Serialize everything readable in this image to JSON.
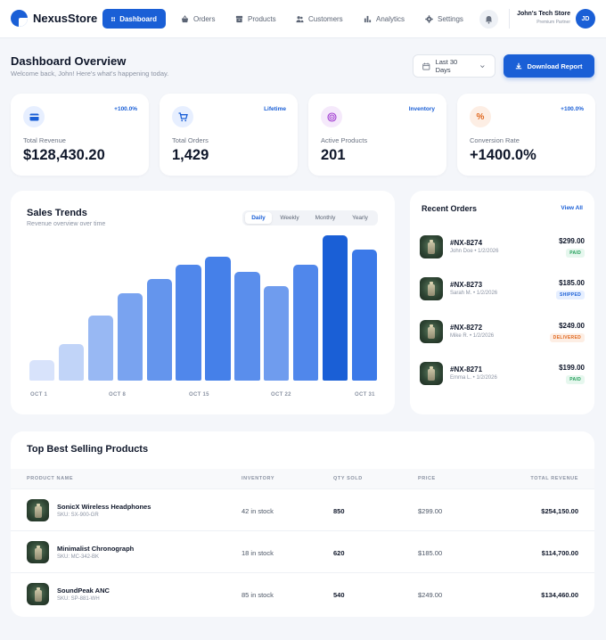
{
  "brand": {
    "name": "NexusStore",
    "color": "#1a5fd6"
  },
  "nav": {
    "tabs": [
      {
        "label": "Dashboard",
        "icon": "grid-icon",
        "active": true
      },
      {
        "label": "Orders",
        "icon": "basket-icon"
      },
      {
        "label": "Products",
        "icon": "box-icon"
      },
      {
        "label": "Customers",
        "icon": "users-icon"
      },
      {
        "label": "Analytics",
        "icon": "bar-chart-icon"
      },
      {
        "label": "Settings",
        "icon": "gear-icon"
      }
    ],
    "store_name": "John's Tech Store",
    "store_tier": "Premium Partner",
    "avatar_initials": "JD"
  },
  "header": {
    "title": "Dashboard Overview",
    "subtitle": "Welcome back, John! Here's what's happening today.",
    "date_range": "Last 30 Days",
    "download_label": "Download Report"
  },
  "kpis": [
    {
      "label": "Total Revenue",
      "value": "$128,430.20",
      "badge": "+100.0%",
      "icon": "card-icon",
      "icon_bg": "#e7efff",
      "icon_color": "#1a5fd6"
    },
    {
      "label": "Total Orders",
      "value": "1,429",
      "badge": "Lifetime",
      "icon": "cart-icon",
      "icon_bg": "#e7efff",
      "icon_color": "#1a5fd6"
    },
    {
      "label": "Active Products",
      "value": "201",
      "badge": "Inventory",
      "icon": "target-icon",
      "icon_bg": "#f5e9fb",
      "icon_color": "#a23fd1"
    },
    {
      "label": "Conversion Rate",
      "value": "+1400.0%",
      "badge": "+100.0%",
      "icon": "percent-icon",
      "icon_bg": "#fdeee4",
      "icon_color": "#e0681f"
    }
  ],
  "sales_trends": {
    "title": "Sales Trends",
    "subtitle": "Revenue overview over time",
    "ranges": [
      "Daily",
      "Weekly",
      "Monthly",
      "Yearly"
    ],
    "active_range": "Daily"
  },
  "chart_data": {
    "type": "bar",
    "x_ticks": [
      "OCT 1",
      "OCT 8",
      "OCT 15",
      "OCT 22",
      "OCT 31"
    ],
    "values": [
      14,
      25,
      45,
      60,
      70,
      80,
      85,
      75,
      65,
      80,
      100,
      90
    ],
    "ylim": [
      0,
      100
    ],
    "highlight_index": 10,
    "grid": false
  },
  "recent_orders": {
    "title": "Recent Orders",
    "view_all": "View All",
    "items": [
      {
        "id": "#NX-8274",
        "meta": "John Doe • 1/2/2026",
        "amount": "$299.00",
        "status": "PAID",
        "status_kind": "paid"
      },
      {
        "id": "#NX-8273",
        "meta": "Sarah M. • 1/2/2026",
        "amount": "$185.00",
        "status": "SHIPPED",
        "status_kind": "shipped"
      },
      {
        "id": "#NX-8272",
        "meta": "Mike R. • 1/2/2026",
        "amount": "$249.00",
        "status": "DELIVERED",
        "status_kind": "delivered"
      },
      {
        "id": "#NX-8271",
        "meta": "Emma L. • 1/2/2026",
        "amount": "$199.00",
        "status": "PAID",
        "status_kind": "paid"
      }
    ]
  },
  "best_sellers": {
    "title": "Top Best Selling Products",
    "columns": [
      "PRODUCT NAME",
      "INVENTORY",
      "QTY SOLD",
      "PRICE",
      "TOTAL REVENUE"
    ],
    "rows": [
      {
        "name": "SonicX Wireless Headphones",
        "sku": "SKU: SX-900-GR",
        "inventory": "42 in stock",
        "qty": "850",
        "price": "$299.00",
        "revenue": "$254,150.00"
      },
      {
        "name": "Minimalist Chronograph",
        "sku": "SKU: MC-342-BK",
        "inventory": "18 in stock",
        "qty": "620",
        "price": "$185.00",
        "revenue": "$114,700.00"
      },
      {
        "name": "SoundPeak ANC",
        "sku": "SKU: SP-881-WH",
        "inventory": "85 in stock",
        "qty": "540",
        "price": "$249.00",
        "revenue": "$134,460.00"
      }
    ]
  }
}
